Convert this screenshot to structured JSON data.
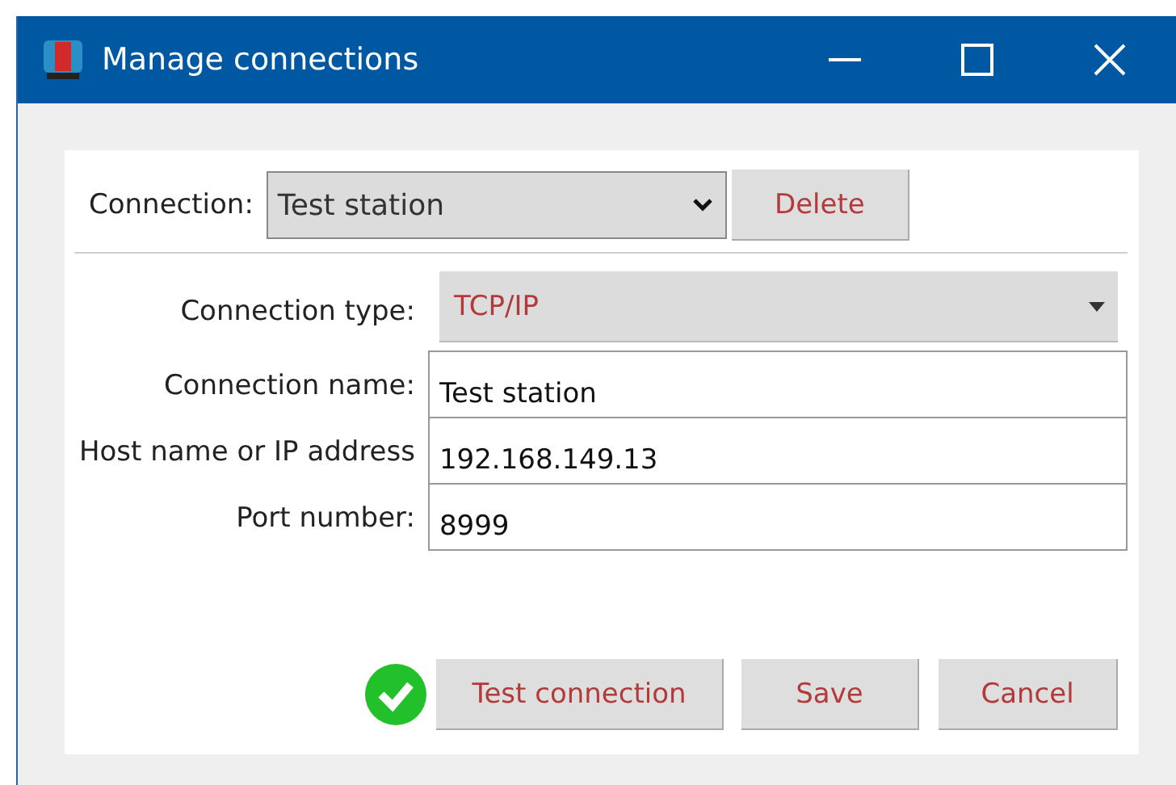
{
  "window": {
    "title": "Manage connections"
  },
  "connection": {
    "label": "Connection:",
    "value": "Test station",
    "delete_button": "Delete"
  },
  "fields": [
    {
      "kind": "select",
      "label": "Connection type:",
      "value": "TCP/IP"
    },
    {
      "kind": "input",
      "label": "Connection name:",
      "value": "Test station"
    },
    {
      "kind": "input",
      "label": "Host name or IP address",
      "value": "192.168.149.13"
    },
    {
      "kind": "input",
      "label": "Port number:",
      "value": "8999"
    }
  ],
  "test_passed": true,
  "buttons": [
    "Test connection",
    "Save",
    "Cancel"
  ]
}
